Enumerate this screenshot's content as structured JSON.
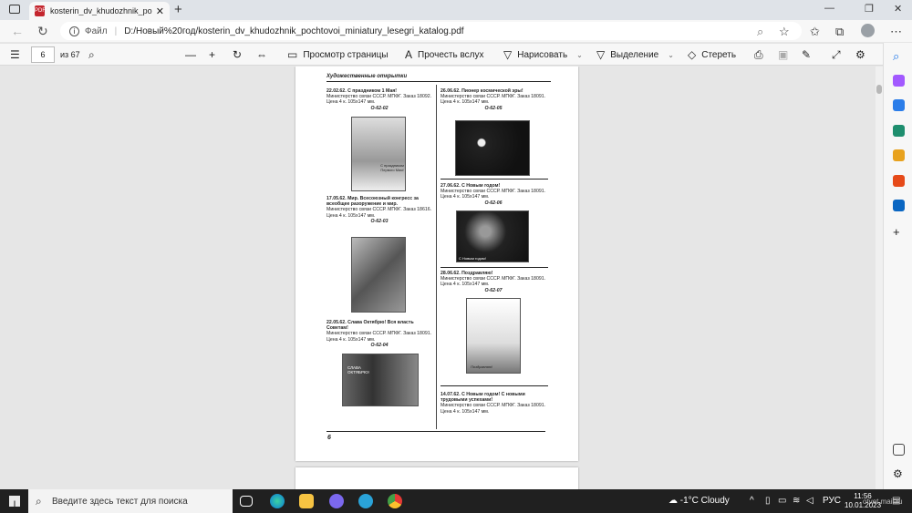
{
  "browser": {
    "tab_title": "kosterin_dv_khudozhnik_pochtovoi_miniatury_lesegri_katalog.pdf",
    "tab_title_short": "kosterin_dv_khudozhnik_pochtov",
    "url_label": "Файл",
    "url": "D:/Новый%20год/kosterin_dv_khudozhnik_pochtovoi_miniatury_lesegri_katalog.pdf"
  },
  "pdf_toolbar": {
    "page_current": "6",
    "page_total": "из 67",
    "page_view": "Просмотр страницы",
    "read_aloud": "Прочесть вслух",
    "draw": "Нарисовать",
    "highlight": "Выделение",
    "erase": "Стереть"
  },
  "document": {
    "section_title": "Художественные открытки",
    "page_number": "6",
    "entries": [
      {
        "heading": "22.02.62. С праздником 1 Мая!",
        "body": "Министерство связи СССР. МПФГ. Заказ 18092. Цена 4 к. 105х147 мм.",
        "code": "О-62-02",
        "card_text": "С праздником Первого Мая!"
      },
      {
        "heading": "17.05.62. Мир. Всесоюзный конгресс за всеобщее разоружение и мир.",
        "body": "Министерство связи СССР. МПФГ. Заказ 18616. Цена 4 к. 105х147 мм.",
        "code": "О-62-03",
        "card_text": ""
      },
      {
        "heading": "22.05.62. Слава Октябрю! Вся власть Советам!",
        "body": "Министерство связи СССР. МПФГ. Заказ 18091. Цена 4 к. 105х147 мм.",
        "code": "О-62-04",
        "card_text": "СЛАВА ОКТЯБРЮ!"
      },
      {
        "heading": "26.06.62. Пионер космической эры!",
        "body": "Министерство связи СССР. МПФГ. Заказ 18091. Цена 4 к. 105х147 мм.",
        "code": "О-62-05",
        "card_text": ""
      },
      {
        "heading": "27.06.62. С Новым годом!",
        "body": "Министерство связи СССР. МПФГ. Заказ 18091. Цена 4 к. 105х147 мм.",
        "code": "О-62-06",
        "card_text": "С Новым годом!"
      },
      {
        "heading": "28.06.62. Поздравляю!",
        "body": "Министерство связи СССР. МПФГ. Заказ 18091. Цена 4 к. 105х147 мм.",
        "code": "О-62-07",
        "card_text": "Поздравляю!"
      },
      {
        "heading": "14.07.62. С Новым годом! С новыми трудовыми успехами!",
        "body": "Министерство связи СССР. МПФГ. Заказ 18091. Цена 4 к. 105х147 мм.",
        "code": "",
        "card_text": ""
      }
    ]
  },
  "taskbar": {
    "search_placeholder": "Введите здесь текст для поиска",
    "weather": "-1°C  Cloudy",
    "lang": "РУС",
    "time": "11:56",
    "date": "10.01.2023",
    "watermark": "otvet.mail.ru"
  }
}
